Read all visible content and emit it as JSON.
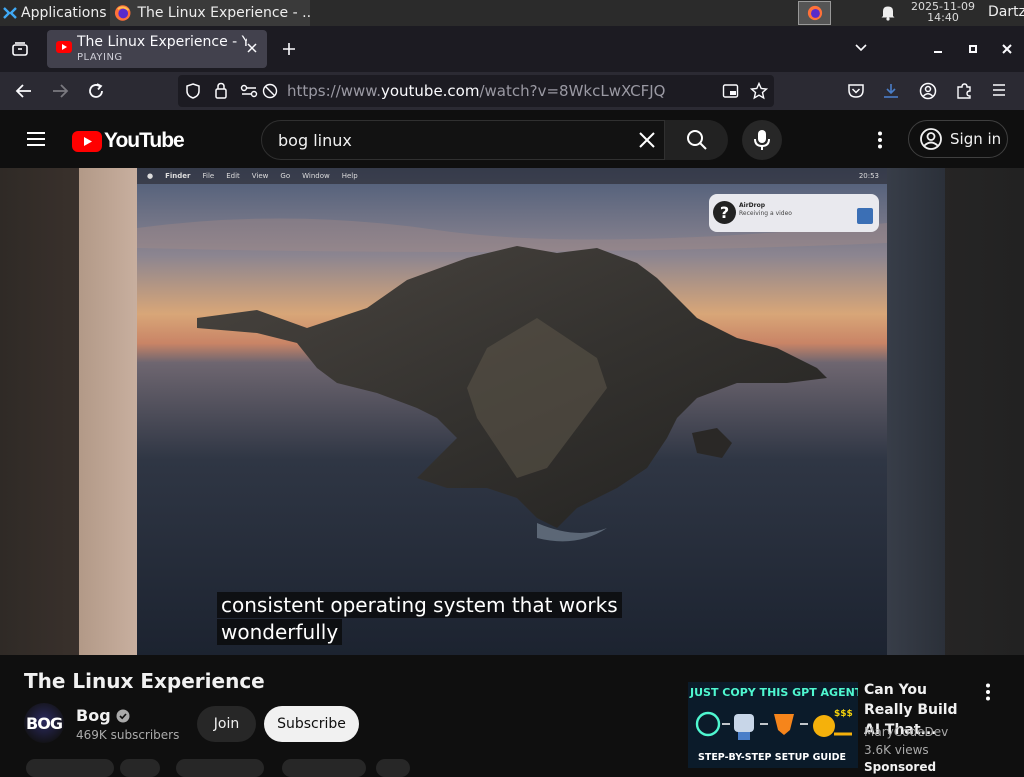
{
  "taskbar": {
    "applications_label": "Applications",
    "task_title": "The Linux Experience - ...",
    "clock_date": "2025-11-09",
    "clock_time": "14:40",
    "user": "Dartz"
  },
  "browser": {
    "tab_title": "The Linux Experience - YouTube",
    "tab_status": "PLAYING",
    "url_prefix": "https://www.",
    "url_domain": "youtube.com",
    "url_path": "/watch?v=8WkcLwXCFJQ"
  },
  "youtube": {
    "logo_text": "YouTube",
    "search_query": "bog linux",
    "sign_in_label": "Sign in"
  },
  "player": {
    "inner_menubar": [
      "Finder",
      "File",
      "Edit",
      "View",
      "Go",
      "Window",
      "Help"
    ],
    "inner_clock": "20:53",
    "airdrop_title": "AirDrop",
    "airdrop_sub": "Receiving a video",
    "caption_line1": "consistent operating system that works",
    "caption_line2": "wonderfully"
  },
  "video": {
    "title": "The Linux Experience",
    "channel_name": "Bog",
    "avatar_text": "BOG",
    "subscribers": "469K subscribers",
    "join_label": "Join",
    "subscribe_label": "Subscribe"
  },
  "sidebar_ad": {
    "thumb_headline": "JUST COPY THIS GPT AGENT",
    "thumb_footer": "STEP-BY-STEP SETUP GUIDE",
    "thumb_price": "$$$",
    "title": "Can You Really Build AI That...",
    "channel": "MaryCodeDev",
    "views": "3.6K views",
    "sponsored": "Sponsored"
  },
  "colors": {
    "youtube_red": "#ff0000",
    "firefox_tab_bg": "#42414d",
    "page_bg": "#0f0f0f"
  }
}
